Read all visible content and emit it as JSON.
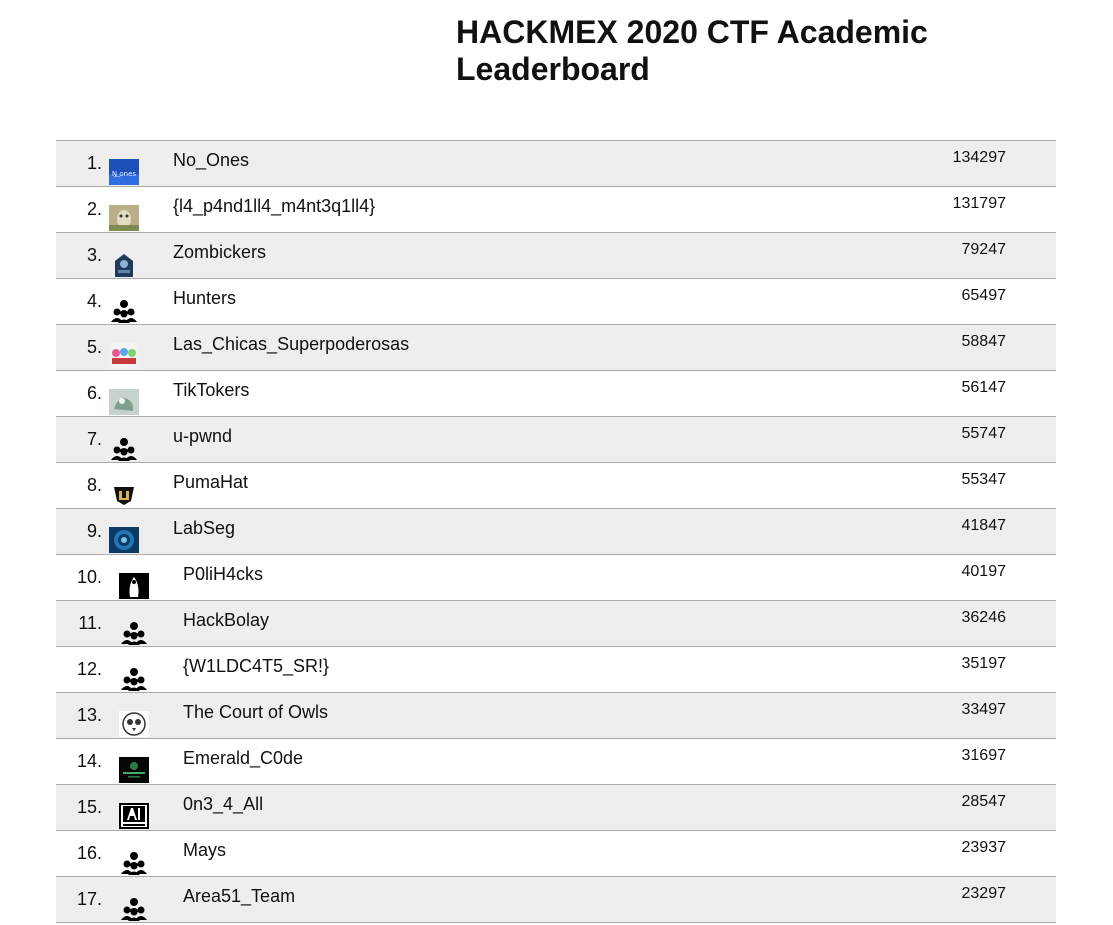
{
  "page": {
    "title": "HACKMEX 2020 CTF Academic Leaderboard"
  },
  "colors": {
    "row_alt": "#eeeeee",
    "row_border": "#a9a9a9",
    "text": "#111111"
  },
  "teams": [
    {
      "rank": "1.",
      "name": "No_Ones",
      "score": "134297",
      "logo": "no-ones-logo"
    },
    {
      "rank": "2.",
      "name": "{l4_p4nd1ll4_m4nt3q1ll4}",
      "score": "131797",
      "logo": "panda-logo"
    },
    {
      "rank": "3.",
      "name": "Zombickers",
      "score": "79247",
      "logo": "zombickers-logo"
    },
    {
      "rank": "4.",
      "name": "Hunters",
      "score": "65497",
      "logo": "team-group-icon"
    },
    {
      "rank": "5.",
      "name": "Las_Chicas_Superpoderosas",
      "score": "58847",
      "logo": "chicas-logo"
    },
    {
      "rank": "6.",
      "name": "TikTokers",
      "score": "56147",
      "logo": "tiktokers-logo"
    },
    {
      "rank": "7.",
      "name": "u-pwnd",
      "score": "55747",
      "logo": "team-group-icon"
    },
    {
      "rank": "8.",
      "name": "PumaHat",
      "score": "55347",
      "logo": "pumahat-logo"
    },
    {
      "rank": "9.",
      "name": "LabSeg",
      "score": "41847",
      "logo": "labseg-logo"
    },
    {
      "rank": "10.",
      "name": "P0liH4cks",
      "score": "40197",
      "logo": "polihacks-logo"
    },
    {
      "rank": "11.",
      "name": "HackBolay",
      "score": "36246",
      "logo": "team-group-icon"
    },
    {
      "rank": "12.",
      "name": "{W1LDC4T5_SR!}",
      "score": "35197",
      "logo": "team-group-icon"
    },
    {
      "rank": "13.",
      "name": "The Court of Owls",
      "score": "33497",
      "logo": "owls-logo"
    },
    {
      "rank": "14.",
      "name": "Emerald_C0de",
      "score": "31697",
      "logo": "emerald-logo"
    },
    {
      "rank": "15.",
      "name": "0n3_4_All",
      "score": "28547",
      "logo": "ua-logo"
    },
    {
      "rank": "16.",
      "name": "Mays",
      "score": "23937",
      "logo": "team-group-icon"
    },
    {
      "rank": "17.",
      "name": "Area51_Team",
      "score": "23297",
      "logo": "team-group-icon"
    }
  ]
}
